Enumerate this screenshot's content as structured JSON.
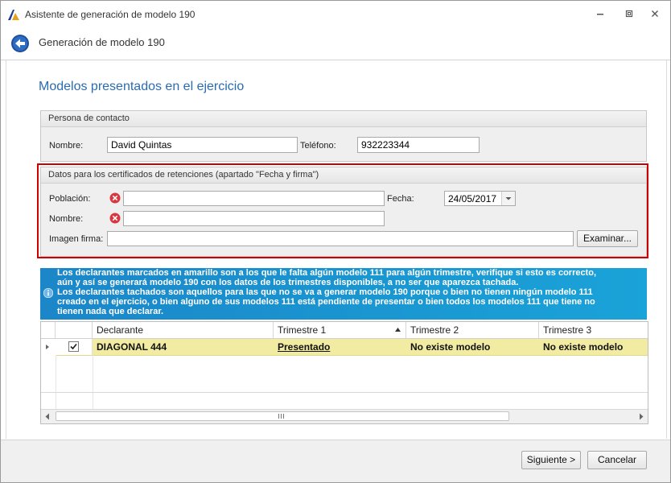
{
  "window": {
    "title": "Asistente de generación de modelo 190",
    "header_title": "Generación de modelo 190"
  },
  "section_title": "Modelos presentados en el ejercicio",
  "contact": {
    "group_title": "Persona de contacto",
    "name_label": "Nombre:",
    "name_value": "David Quintas",
    "phone_label": "Teléfono:",
    "phone_value": "932223344"
  },
  "certificates": {
    "group_title": "Datos para los certificados de retenciones (apartado \"Fecha y firma\")",
    "poblacion_label": "Población:",
    "poblacion_value": "",
    "fecha_label": "Fecha:",
    "fecha_value": "24/05/2017",
    "nombre_label": "Nombre:",
    "nombre_value": "",
    "imagen_label": "Imagen firma:",
    "imagen_value": "",
    "examinar_label": "Examinar..."
  },
  "info": {
    "lines": [
      "Los declarantes marcados en amarillo son a los que le falta algún modelo 111 para algún trimestre, verifique si esto es correcto,",
      "aún y así se generará modelo 190 con los datos de los trimestres disponibles, a no ser que aparezca tachada.",
      "Los declarantes tachados son aquellos para las que no se va a generar modelo 190 porque o bien no tienen ningún modelo 111",
      "creado en el ejercicio, o bien alguno de sus modelos 111 está pendiente de presentar o bien todos los modelos 111 que tiene no",
      "tienen nada que declarar."
    ]
  },
  "grid": {
    "columns": [
      "Declarante",
      "Trimestre 1",
      "Trimestre 2",
      "Trimestre 3"
    ],
    "rows": [
      {
        "checked": true,
        "declarante": "DIAGONAL 444",
        "t1": "Presentado",
        "t2": "No existe modelo",
        "t3": "No existe modelo"
      }
    ],
    "row_highlight_color": "#f2eca2"
  },
  "footer": {
    "next_label": "Siguiente >",
    "cancel_label": "Cancelar"
  },
  "colors": {
    "accent": "#2b6cb0",
    "error_red": "#d9363e",
    "highlight_border": "#d10000",
    "info_bar": "#1b86c8"
  }
}
